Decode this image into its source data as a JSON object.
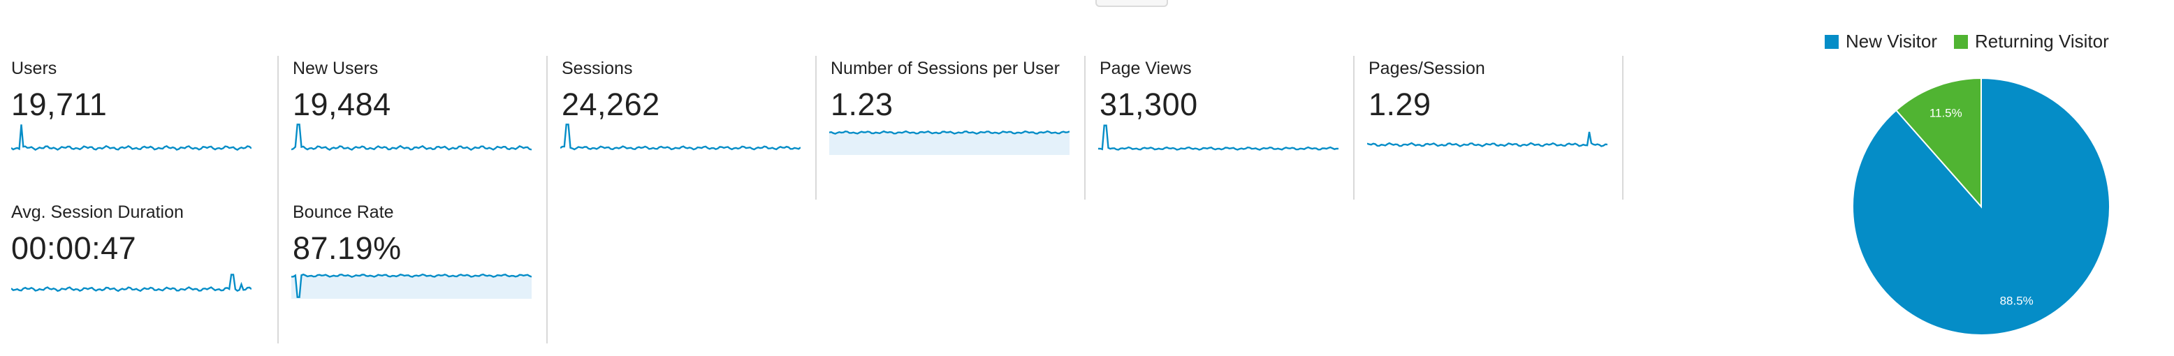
{
  "metrics": [
    {
      "label": "Users",
      "value": "19,711",
      "style": "line"
    },
    {
      "label": "New Users",
      "value": "19,484",
      "style": "line"
    },
    {
      "label": "Sessions",
      "value": "24,262",
      "style": "line"
    },
    {
      "label": "Number of Sessions per User",
      "value": "1.23",
      "style": "area"
    },
    {
      "label": "Page Views",
      "value": "31,300",
      "style": "line"
    },
    {
      "label": "Pages/Session",
      "value": "1.29",
      "style": "line"
    },
    {
      "label": "Avg. Session Duration",
      "value": "00:00:47",
      "style": "line"
    },
    {
      "label": "Bounce Rate",
      "value": "87.19%",
      "style": "area"
    }
  ],
  "legend": {
    "new_visitor": "New Visitor",
    "returning_visitor": "Returning Visitor"
  },
  "colors": {
    "new_visitor": "#058dc7",
    "returning_visitor": "#50b432",
    "sparkline": "#058dc7",
    "sparkline_fill": "#e4f1fa"
  },
  "chart_data": {
    "type": "pie",
    "categories": [
      "New Visitor",
      "Returning Visitor"
    ],
    "values": [
      88.5,
      11.5
    ],
    "labels": [
      "88.5%",
      "11.5%"
    ]
  }
}
